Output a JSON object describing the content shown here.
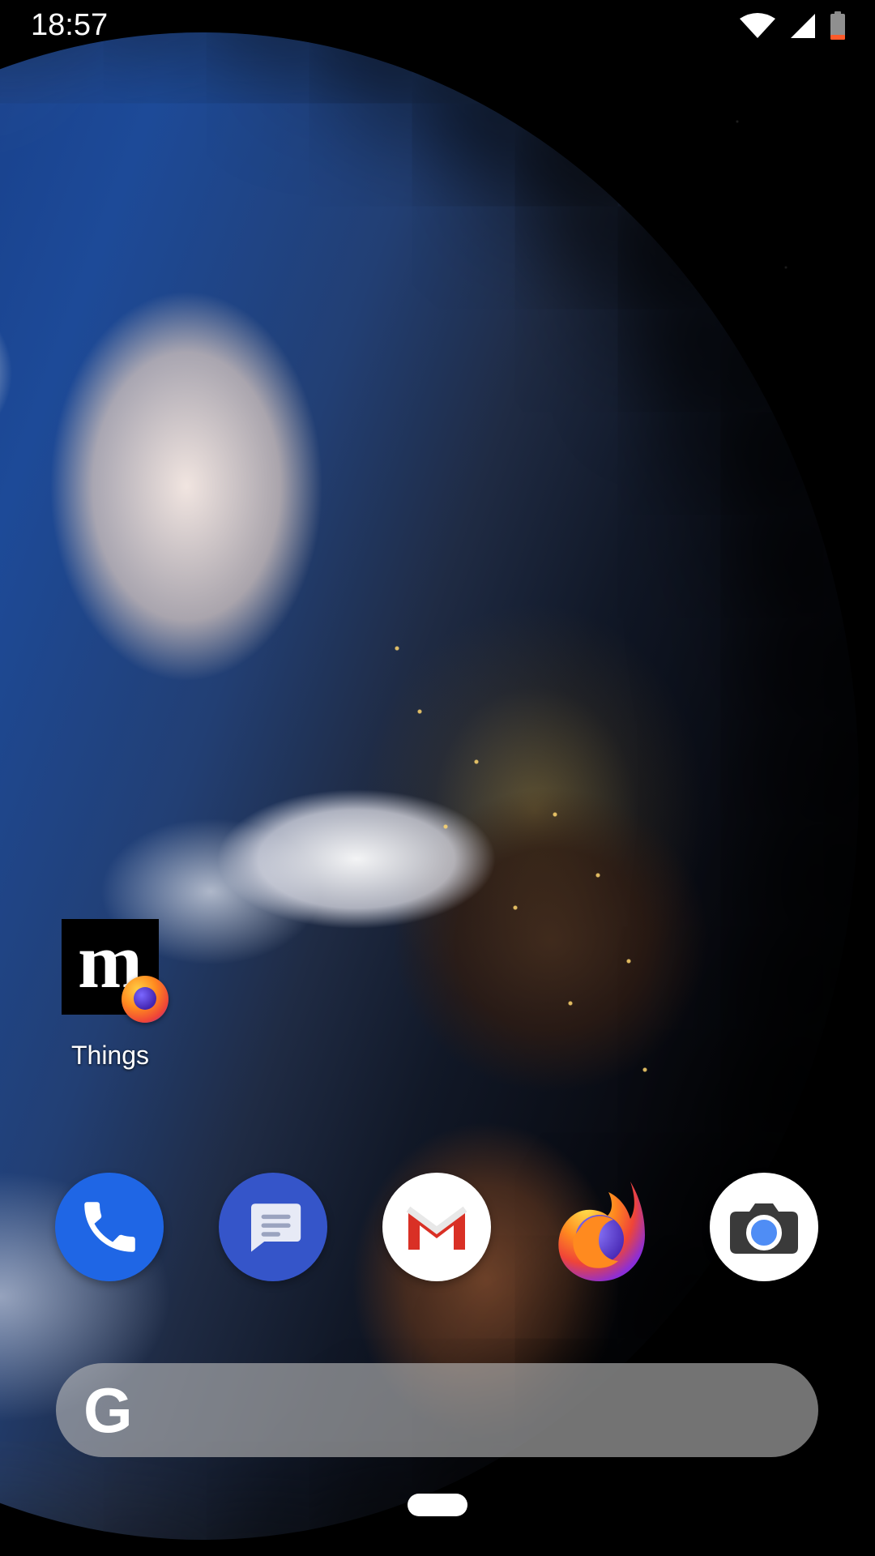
{
  "status_bar": {
    "time": "18:57",
    "icons": [
      "wifi-icon",
      "signal-icon",
      "battery-icon"
    ]
  },
  "desktop_apps": [
    {
      "label": "Things",
      "tile_letter": "m",
      "badge_icon": "firefox-badge-icon"
    }
  ],
  "dock": [
    {
      "name": "phone",
      "icon": "phone-icon"
    },
    {
      "name": "messages",
      "icon": "messages-icon"
    },
    {
      "name": "gmail",
      "icon": "gmail-icon"
    },
    {
      "name": "firefox",
      "icon": "firefox-icon"
    },
    {
      "name": "camera",
      "icon": "camera-icon"
    }
  ],
  "search": {
    "logo": "G",
    "value": ""
  },
  "colors": {
    "phone": "#1f66e5",
    "messages": "#3555c9",
    "gmail_red": "#d93025",
    "firefox_orange": "#ff8a1f",
    "camera_blue": "#4f8df5",
    "search_bar": "#b9b9b9"
  }
}
